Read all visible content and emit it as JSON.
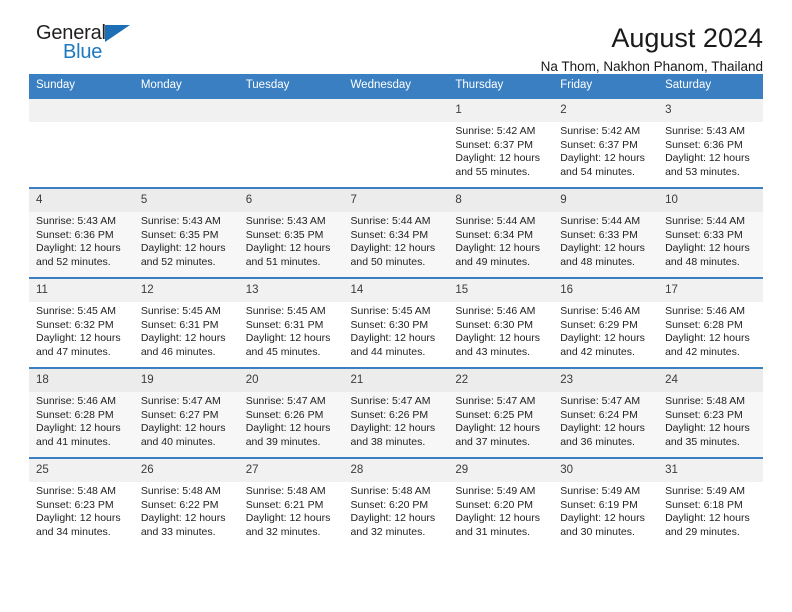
{
  "brand": {
    "name_part1": "General",
    "name_part2": "Blue",
    "flag_icon": "blue-triangle-flag-icon",
    "accent_color": "#1c79c0"
  },
  "header": {
    "title": "August 2024",
    "subtitle": "Na Thom, Nakhon Phanom, Thailand"
  },
  "theme": {
    "header_row_bg": "#3a7fc1",
    "row_divider": "#3a7fc1",
    "daynum_band_bg": "#f1f1f1",
    "shaded_row_bg": "#f7f7f7",
    "text_color": "#222222"
  },
  "calendar": {
    "day_headers": [
      "Sunday",
      "Monday",
      "Tuesday",
      "Wednesday",
      "Thursday",
      "Friday",
      "Saturday"
    ],
    "labels": {
      "sunrise": "Sunrise:",
      "sunset": "Sunset:",
      "daylight": "Daylight:"
    },
    "weeks": [
      {
        "shaded": false,
        "days": [
          {
            "day": "",
            "empty": true,
            "sunrise": "",
            "sunset": "",
            "daylight_line1": "",
            "daylight_line2": ""
          },
          {
            "day": "",
            "empty": true,
            "sunrise": "",
            "sunset": "",
            "daylight_line1": "",
            "daylight_line2": ""
          },
          {
            "day": "",
            "empty": true,
            "sunrise": "",
            "sunset": "",
            "daylight_line1": "",
            "daylight_line2": ""
          },
          {
            "day": "",
            "empty": true,
            "sunrise": "",
            "sunset": "",
            "daylight_line1": "",
            "daylight_line2": ""
          },
          {
            "day": "1",
            "empty": false,
            "sunrise": "Sunrise: 5:42 AM",
            "sunset": "Sunset: 6:37 PM",
            "daylight_line1": "Daylight: 12 hours",
            "daylight_line2": "and 55 minutes."
          },
          {
            "day": "2",
            "empty": false,
            "sunrise": "Sunrise: 5:42 AM",
            "sunset": "Sunset: 6:37 PM",
            "daylight_line1": "Daylight: 12 hours",
            "daylight_line2": "and 54 minutes."
          },
          {
            "day": "3",
            "empty": false,
            "sunrise": "Sunrise: 5:43 AM",
            "sunset": "Sunset: 6:36 PM",
            "daylight_line1": "Daylight: 12 hours",
            "daylight_line2": "and 53 minutes."
          }
        ]
      },
      {
        "shaded": true,
        "days": [
          {
            "day": "4",
            "empty": false,
            "sunrise": "Sunrise: 5:43 AM",
            "sunset": "Sunset: 6:36 PM",
            "daylight_line1": "Daylight: 12 hours",
            "daylight_line2": "and 52 minutes."
          },
          {
            "day": "5",
            "empty": false,
            "sunrise": "Sunrise: 5:43 AM",
            "sunset": "Sunset: 6:35 PM",
            "daylight_line1": "Daylight: 12 hours",
            "daylight_line2": "and 52 minutes."
          },
          {
            "day": "6",
            "empty": false,
            "sunrise": "Sunrise: 5:43 AM",
            "sunset": "Sunset: 6:35 PM",
            "daylight_line1": "Daylight: 12 hours",
            "daylight_line2": "and 51 minutes."
          },
          {
            "day": "7",
            "empty": false,
            "sunrise": "Sunrise: 5:44 AM",
            "sunset": "Sunset: 6:34 PM",
            "daylight_line1": "Daylight: 12 hours",
            "daylight_line2": "and 50 minutes."
          },
          {
            "day": "8",
            "empty": false,
            "sunrise": "Sunrise: 5:44 AM",
            "sunset": "Sunset: 6:34 PM",
            "daylight_line1": "Daylight: 12 hours",
            "daylight_line2": "and 49 minutes."
          },
          {
            "day": "9",
            "empty": false,
            "sunrise": "Sunrise: 5:44 AM",
            "sunset": "Sunset: 6:33 PM",
            "daylight_line1": "Daylight: 12 hours",
            "daylight_line2": "and 48 minutes."
          },
          {
            "day": "10",
            "empty": false,
            "sunrise": "Sunrise: 5:44 AM",
            "sunset": "Sunset: 6:33 PM",
            "daylight_line1": "Daylight: 12 hours",
            "daylight_line2": "and 48 minutes."
          }
        ]
      },
      {
        "shaded": false,
        "days": [
          {
            "day": "11",
            "empty": false,
            "sunrise": "Sunrise: 5:45 AM",
            "sunset": "Sunset: 6:32 PM",
            "daylight_line1": "Daylight: 12 hours",
            "daylight_line2": "and 47 minutes."
          },
          {
            "day": "12",
            "empty": false,
            "sunrise": "Sunrise: 5:45 AM",
            "sunset": "Sunset: 6:31 PM",
            "daylight_line1": "Daylight: 12 hours",
            "daylight_line2": "and 46 minutes."
          },
          {
            "day": "13",
            "empty": false,
            "sunrise": "Sunrise: 5:45 AM",
            "sunset": "Sunset: 6:31 PM",
            "daylight_line1": "Daylight: 12 hours",
            "daylight_line2": "and 45 minutes."
          },
          {
            "day": "14",
            "empty": false,
            "sunrise": "Sunrise: 5:45 AM",
            "sunset": "Sunset: 6:30 PM",
            "daylight_line1": "Daylight: 12 hours",
            "daylight_line2": "and 44 minutes."
          },
          {
            "day": "15",
            "empty": false,
            "sunrise": "Sunrise: 5:46 AM",
            "sunset": "Sunset: 6:30 PM",
            "daylight_line1": "Daylight: 12 hours",
            "daylight_line2": "and 43 minutes."
          },
          {
            "day": "16",
            "empty": false,
            "sunrise": "Sunrise: 5:46 AM",
            "sunset": "Sunset: 6:29 PM",
            "daylight_line1": "Daylight: 12 hours",
            "daylight_line2": "and 42 minutes."
          },
          {
            "day": "17",
            "empty": false,
            "sunrise": "Sunrise: 5:46 AM",
            "sunset": "Sunset: 6:28 PM",
            "daylight_line1": "Daylight: 12 hours",
            "daylight_line2": "and 42 minutes."
          }
        ]
      },
      {
        "shaded": true,
        "days": [
          {
            "day": "18",
            "empty": false,
            "sunrise": "Sunrise: 5:46 AM",
            "sunset": "Sunset: 6:28 PM",
            "daylight_line1": "Daylight: 12 hours",
            "daylight_line2": "and 41 minutes."
          },
          {
            "day": "19",
            "empty": false,
            "sunrise": "Sunrise: 5:47 AM",
            "sunset": "Sunset: 6:27 PM",
            "daylight_line1": "Daylight: 12 hours",
            "daylight_line2": "and 40 minutes."
          },
          {
            "day": "20",
            "empty": false,
            "sunrise": "Sunrise: 5:47 AM",
            "sunset": "Sunset: 6:26 PM",
            "daylight_line1": "Daylight: 12 hours",
            "daylight_line2": "and 39 minutes."
          },
          {
            "day": "21",
            "empty": false,
            "sunrise": "Sunrise: 5:47 AM",
            "sunset": "Sunset: 6:26 PM",
            "daylight_line1": "Daylight: 12 hours",
            "daylight_line2": "and 38 minutes."
          },
          {
            "day": "22",
            "empty": false,
            "sunrise": "Sunrise: 5:47 AM",
            "sunset": "Sunset: 6:25 PM",
            "daylight_line1": "Daylight: 12 hours",
            "daylight_line2": "and 37 minutes."
          },
          {
            "day": "23",
            "empty": false,
            "sunrise": "Sunrise: 5:47 AM",
            "sunset": "Sunset: 6:24 PM",
            "daylight_line1": "Daylight: 12 hours",
            "daylight_line2": "and 36 minutes."
          },
          {
            "day": "24",
            "empty": false,
            "sunrise": "Sunrise: 5:48 AM",
            "sunset": "Sunset: 6:23 PM",
            "daylight_line1": "Daylight: 12 hours",
            "daylight_line2": "and 35 minutes."
          }
        ]
      },
      {
        "shaded": false,
        "days": [
          {
            "day": "25",
            "empty": false,
            "sunrise": "Sunrise: 5:48 AM",
            "sunset": "Sunset: 6:23 PM",
            "daylight_line1": "Daylight: 12 hours",
            "daylight_line2": "and 34 minutes."
          },
          {
            "day": "26",
            "empty": false,
            "sunrise": "Sunrise: 5:48 AM",
            "sunset": "Sunset: 6:22 PM",
            "daylight_line1": "Daylight: 12 hours",
            "daylight_line2": "and 33 minutes."
          },
          {
            "day": "27",
            "empty": false,
            "sunrise": "Sunrise: 5:48 AM",
            "sunset": "Sunset: 6:21 PM",
            "daylight_line1": "Daylight: 12 hours",
            "daylight_line2": "and 32 minutes."
          },
          {
            "day": "28",
            "empty": false,
            "sunrise": "Sunrise: 5:48 AM",
            "sunset": "Sunset: 6:20 PM",
            "daylight_line1": "Daylight: 12 hours",
            "daylight_line2": "and 32 minutes."
          },
          {
            "day": "29",
            "empty": false,
            "sunrise": "Sunrise: 5:49 AM",
            "sunset": "Sunset: 6:20 PM",
            "daylight_line1": "Daylight: 12 hours",
            "daylight_line2": "and 31 minutes."
          },
          {
            "day": "30",
            "empty": false,
            "sunrise": "Sunrise: 5:49 AM",
            "sunset": "Sunset: 6:19 PM",
            "daylight_line1": "Daylight: 12 hours",
            "daylight_line2": "and 30 minutes."
          },
          {
            "day": "31",
            "empty": false,
            "sunrise": "Sunrise: 5:49 AM",
            "sunset": "Sunset: 6:18 PM",
            "daylight_line1": "Daylight: 12 hours",
            "daylight_line2": "and 29 minutes."
          }
        ]
      }
    ]
  }
}
